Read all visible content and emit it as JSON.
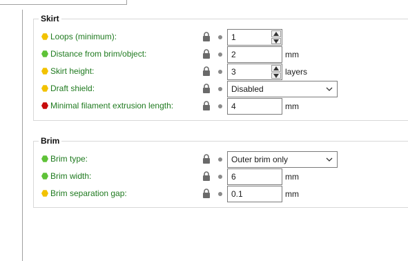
{
  "skirt": {
    "title": "Skirt",
    "loops": {
      "label": "Loops (minimum):",
      "value": "1"
    },
    "distance": {
      "label": "Distance from brim/object:",
      "value": "2",
      "unit": "mm"
    },
    "height": {
      "label": "Skirt height:",
      "value": "3",
      "unit": "layers"
    },
    "draft_shield": {
      "label": "Draft shield:",
      "value": "Disabled"
    },
    "min_extrusion": {
      "label": "Minimal filament extrusion length:",
      "value": "4",
      "unit": "mm"
    }
  },
  "brim": {
    "title": "Brim",
    "type": {
      "label": "Brim type:",
      "value": "Outer brim only"
    },
    "width": {
      "label": "Brim width:",
      "value": "6",
      "unit": "mm"
    },
    "gap": {
      "label": "Brim separation gap:",
      "value": "0.1",
      "unit": "mm"
    }
  },
  "colors": {
    "simple_mode": "#f2c200",
    "advanced_mode": "#5fc238",
    "expert_mode": "#c70c0c",
    "label_text": "#1f7a1f"
  },
  "icons": [
    "lock-icon",
    "bullet-icon",
    "spin-up-icon",
    "spin-down-icon",
    "chevron-down-icon",
    "mode-hexagon-icon"
  ]
}
